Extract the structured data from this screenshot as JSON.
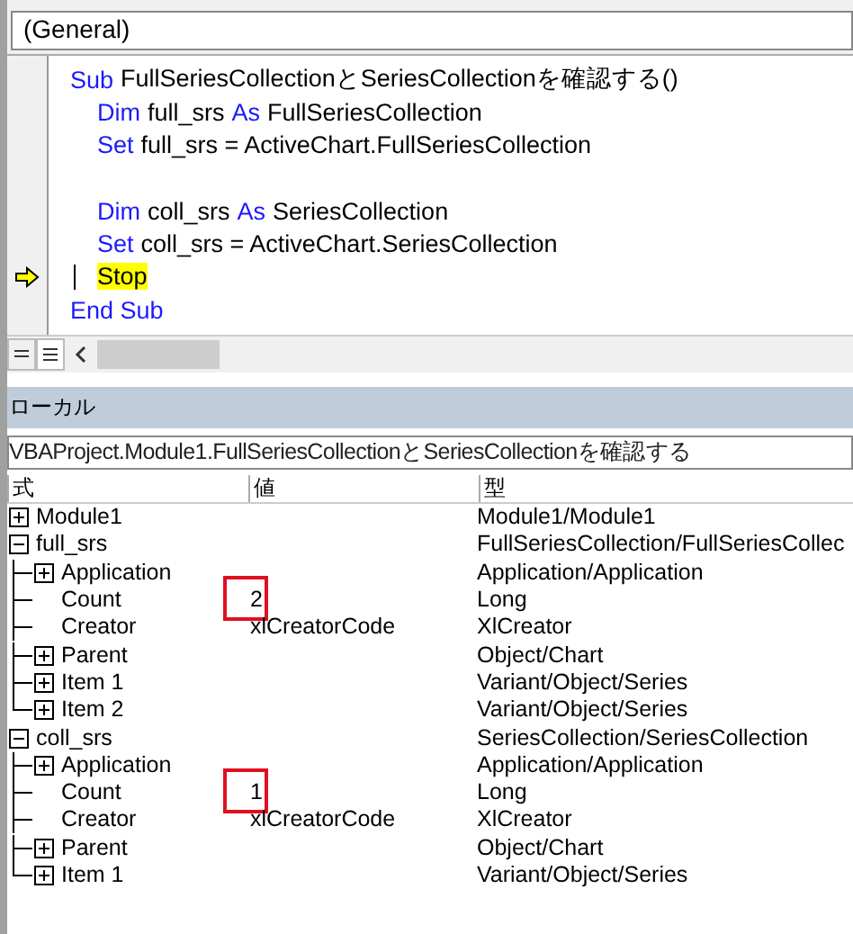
{
  "code_window": {
    "procedure_box": "(General)",
    "lines": [
      {
        "kind": "code",
        "indented": false,
        "current": false,
        "tokens": [
          {
            "kind": "keyword",
            "text": "Sub"
          },
          {
            "kind": "plain",
            "text": "FullSeriesCollectionとSeriesCollectionを確認する()"
          }
        ]
      },
      {
        "kind": "code",
        "indented": true,
        "current": false,
        "tokens": [
          {
            "kind": "keyword",
            "text": "Dim"
          },
          {
            "kind": "plain",
            "text": "full_srs"
          },
          {
            "kind": "keyword",
            "text": "As"
          },
          {
            "kind": "plain",
            "text": "FullSeriesCollection"
          }
        ]
      },
      {
        "kind": "code",
        "indented": true,
        "current": false,
        "tokens": [
          {
            "kind": "keyword",
            "text": "Set"
          },
          {
            "kind": "plain",
            "text": "full_srs = ActiveChart.FullSeriesCollection"
          }
        ]
      },
      {
        "kind": "blank"
      },
      {
        "kind": "code",
        "indented": true,
        "current": false,
        "tokens": [
          {
            "kind": "keyword",
            "text": "Dim"
          },
          {
            "kind": "plain",
            "text": "coll_srs"
          },
          {
            "kind": "keyword",
            "text": "As"
          },
          {
            "kind": "plain",
            "text": "SeriesCollection"
          }
        ]
      },
      {
        "kind": "code",
        "indented": true,
        "current": false,
        "tokens": [
          {
            "kind": "keyword",
            "text": "Set"
          },
          {
            "kind": "plain",
            "text": "coll_srs = ActiveChart.SeriesCollection"
          }
        ]
      },
      {
        "kind": "code",
        "indented": true,
        "current": true,
        "tokens": [
          {
            "kind": "plain",
            "text": "Stop"
          }
        ]
      },
      {
        "kind": "code",
        "indented": false,
        "current": false,
        "tokens": [
          {
            "kind": "keyword",
            "text": "End Sub"
          }
        ]
      }
    ]
  },
  "locals_window": {
    "title": "ローカル",
    "context": "VBAProject.Module1.FullSeriesCollectionとSeriesCollectionを確認する",
    "columns": [
      "式",
      "値",
      "型"
    ],
    "rows": [
      {
        "name": "Module1",
        "type": "Module1/Module1",
        "expanded": false
      },
      {
        "name": "full_srs",
        "type": "FullSeriesCollection/FullSeriesCollec",
        "expanded": true,
        "children": [
          {
            "name": "Application",
            "type": "Application/Application",
            "expanded": false
          },
          {
            "name": "Count",
            "value": "2",
            "type": "Long",
            "highlighted": true
          },
          {
            "name": "Creator",
            "value": "xlCreatorCode",
            "type": "XlCreator"
          },
          {
            "name": "Parent",
            "type": "Object/Chart",
            "expanded": false
          },
          {
            "name": "Item 1",
            "type": "Variant/Object/Series",
            "expanded": false
          },
          {
            "name": "Item 2",
            "type": "Variant/Object/Series",
            "expanded": false
          }
        ]
      },
      {
        "name": "coll_srs",
        "type": "SeriesCollection/SeriesCollection",
        "expanded": true,
        "children": [
          {
            "name": "Application",
            "type": "Application/Application",
            "expanded": false
          },
          {
            "name": "Count",
            "value": "1",
            "type": "Long",
            "highlighted": true
          },
          {
            "name": "Creator",
            "value": "xlCreatorCode",
            "type": "XlCreator"
          },
          {
            "name": "Parent",
            "type": "Object/Chart",
            "expanded": false
          },
          {
            "name": "Item 1",
            "type": "Variant/Object/Series",
            "expanded": false
          }
        ]
      }
    ]
  }
}
